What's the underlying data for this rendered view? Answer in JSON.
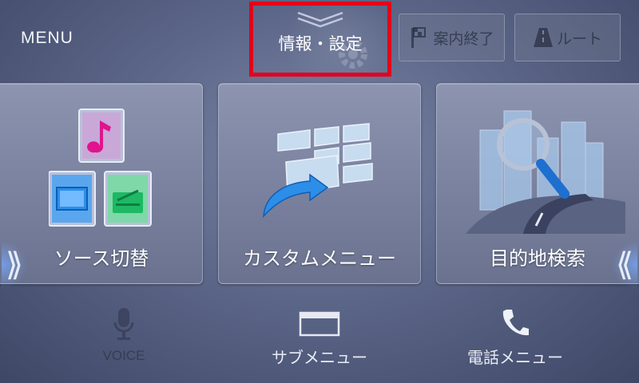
{
  "header": {
    "menu_label": "MENU",
    "info_settings_label": "情報・設定",
    "guide_end_label": "案内終了",
    "route_label": "ルート"
  },
  "tiles": [
    {
      "label": "ソース切替",
      "icon": "source-switch-icon"
    },
    {
      "label": "カスタムメニュー",
      "icon": "custom-menu-icon"
    },
    {
      "label": "目的地検索",
      "icon": "destination-search-icon"
    }
  ],
  "nav": {
    "left_arrow": "⟫",
    "right_arrow": "⟪"
  },
  "bottom": {
    "voice_label": "VOICE",
    "sub_menu_label": "サブメニュー",
    "phone_menu_label": "電話メニュー"
  },
  "colors": {
    "highlight_border": "#e3001b",
    "accent_blue": "#2d8ee8",
    "music_pink": "#e0148c",
    "radio_green": "#1db964"
  }
}
